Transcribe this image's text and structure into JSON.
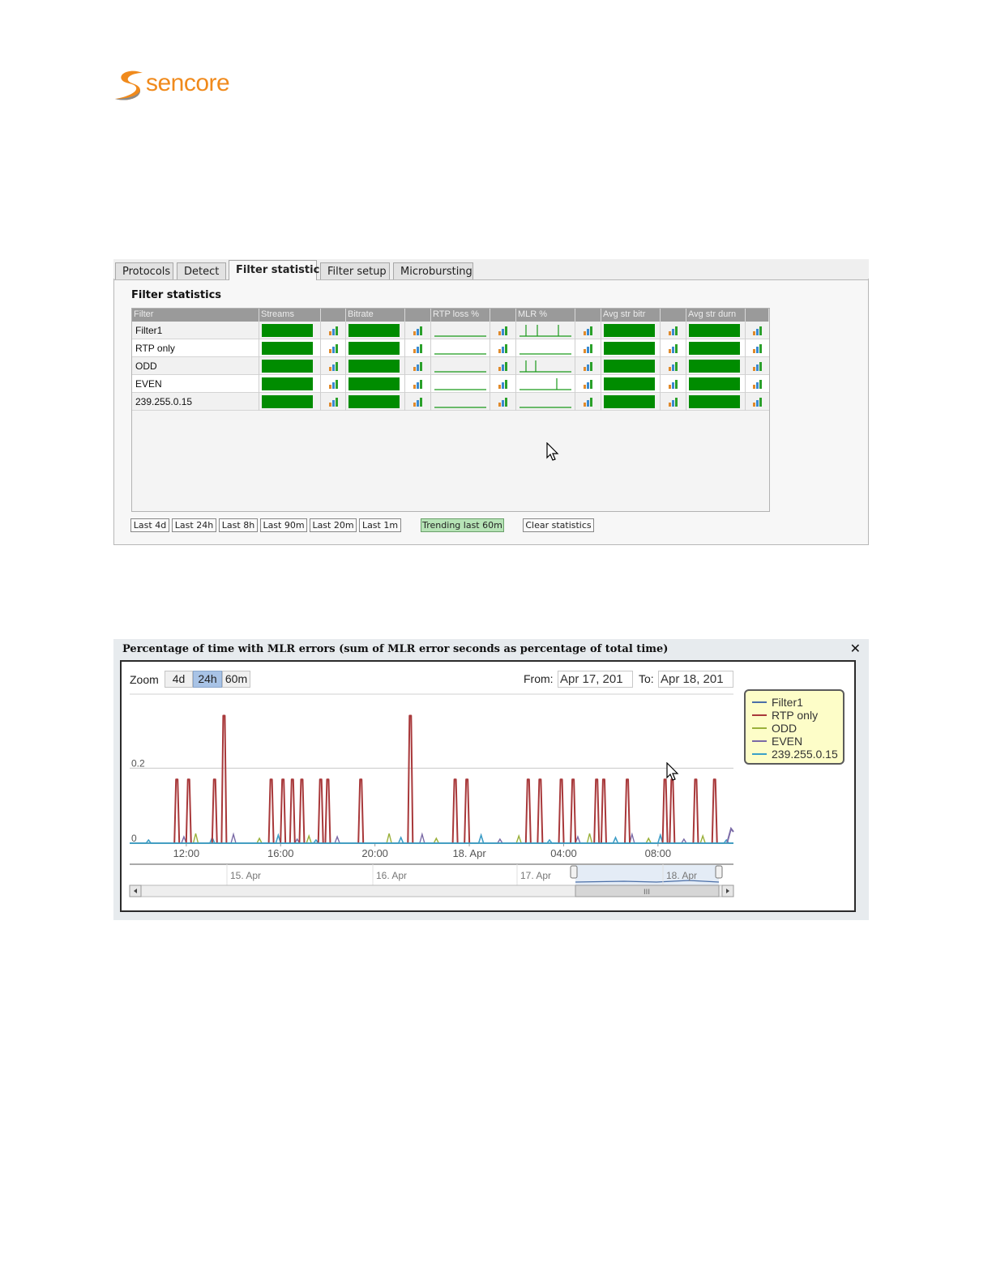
{
  "logo": {
    "text": "sencore"
  },
  "tabs": [
    {
      "label": "Protocols",
      "active": false
    },
    {
      "label": "Detect",
      "active": false
    },
    {
      "label": "Filter statistics",
      "active": true
    },
    {
      "label": "Filter setup",
      "active": false
    },
    {
      "label": "Microbursting",
      "active": false
    }
  ],
  "filter_statistics": {
    "title": "Filter statistics",
    "columns": [
      "Filter",
      "Streams",
      "",
      "Bitrate",
      "",
      "RTP loss %",
      "",
      "MLR %",
      "",
      "Avg str bitr",
      "",
      "Avg str durn",
      ""
    ],
    "rows": [
      {
        "filter": "Filter1"
      },
      {
        "filter": "RTP only"
      },
      {
        "filter": "ODD"
      },
      {
        "filter": "EVEN"
      },
      {
        "filter": "239.255.0.15"
      }
    ],
    "colors": {
      "bar": "#008c00",
      "header": "#9a9a9a"
    }
  },
  "range_buttons": [
    "Last 4d",
    "Last 24h",
    "Last 8h",
    "Last 90m",
    "Last 20m",
    "Last 1m"
  ],
  "trend_button": "Trending last 60m",
  "clear_button": "Clear statistics",
  "chart_panel": {
    "title": "Percentage of time with MLR errors (sum of MLR error seconds as percentage of total time)",
    "close_icon": "close-icon",
    "zoom_label": "Zoom",
    "zoom_options": [
      "4d",
      "24h",
      "60m"
    ],
    "zoom_selected": "24h",
    "from_label": "From:",
    "from_value": "Apr 17, 201",
    "to_label": "To:",
    "to_value": "Apr 18, 201",
    "navigator_labels": [
      "15. Apr",
      "16. Apr",
      "17. Apr",
      "18. Apr"
    ]
  },
  "chart_data": {
    "type": "line",
    "title": "Percentage of time with MLR errors (sum of MLR error seconds as percentage of total time)",
    "xlabel": "",
    "ylabel": "",
    "x_tick_labels": [
      "12:00",
      "16:00",
      "20:00",
      "18. Apr",
      "04:00",
      "08:00"
    ],
    "y_tick_labels": [
      "0",
      "0.2"
    ],
    "ylim": [
      0,
      0.38
    ],
    "legend": [
      "Filter1",
      "RTP only",
      "ODD",
      "EVEN",
      "239.255.0.15"
    ],
    "legend_position": "top-right",
    "series": [
      {
        "name": "RTP only",
        "color": "#a8383a",
        "spikes_hours": [
          11.6,
          12.1,
          13.2,
          13.6,
          15.6,
          16.1,
          16.5,
          16.9,
          17.7,
          18.0,
          19.4,
          21.5,
          23.4,
          23.9,
          26.5,
          27.0,
          27.9,
          28.4,
          29.4,
          29.7,
          30.7,
          32.3,
          32.6,
          33.6,
          34.4
        ],
        "spikes_values": [
          0.17,
          0.17,
          0.17,
          0.34,
          0.17,
          0.17,
          0.17,
          0.17,
          0.17,
          0.17,
          0.17,
          0.34,
          0.17,
          0.17,
          0.17,
          0.17,
          0.17,
          0.17,
          0.17,
          0.17,
          0.17,
          0.17,
          0.17,
          0.17,
          0.17
        ]
      },
      {
        "name": "Filter1",
        "color": "#4b6fa8",
        "values_note": ""
      },
      {
        "name": "ODD",
        "color": "#9ab03a"
      },
      {
        "name": "EVEN",
        "color": "#7a6aa6"
      },
      {
        "name": "239.255.0.15",
        "color": "#3aa0c8"
      }
    ]
  }
}
